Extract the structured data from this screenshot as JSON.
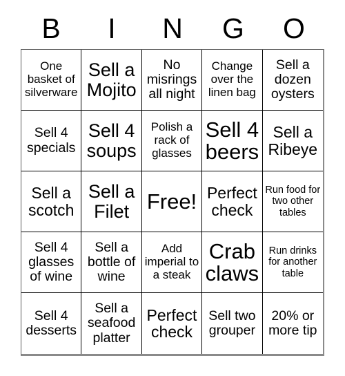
{
  "card": {
    "title_letters": [
      "B",
      "I",
      "N",
      "G",
      "O"
    ],
    "free_space_label": "Free!",
    "rows": [
      [
        {
          "text": "One basket of silverware",
          "size": "sz-s"
        },
        {
          "text": "Sell a Mojito",
          "size": "sz-xl"
        },
        {
          "text": "No misrings all night",
          "size": "sz-m"
        },
        {
          "text": "Change over the linen bag",
          "size": "sz-s"
        },
        {
          "text": "Sell a dozen oysters",
          "size": "sz-m"
        }
      ],
      [
        {
          "text": "Sell 4 specials",
          "size": "sz-m"
        },
        {
          "text": "Sell 4 soups",
          "size": "sz-xl"
        },
        {
          "text": "Polish a rack of glasses",
          "size": "sz-s"
        },
        {
          "text": "Sell 4 beers",
          "size": "sz-xxl"
        },
        {
          "text": "Sell a Ribeye",
          "size": "sz-l"
        }
      ],
      [
        {
          "text": "Sell a scotch",
          "size": "sz-l"
        },
        {
          "text": "Sell a Filet",
          "size": "sz-xl"
        },
        {
          "text": "Free!",
          "size": "sz-xxl"
        },
        {
          "text": "Perfect check",
          "size": "sz-l"
        },
        {
          "text": "Run food for two other tables",
          "size": "sz-xs"
        }
      ],
      [
        {
          "text": "Sell 4 glasses of wine",
          "size": "sz-m"
        },
        {
          "text": "Sell a bottle of wine",
          "size": "sz-m"
        },
        {
          "text": "Add imperial to a steak",
          "size": "sz-s"
        },
        {
          "text": "Crab claws",
          "size": "sz-xxl"
        },
        {
          "text": "Run drinks for another table",
          "size": "sz-xs"
        }
      ],
      [
        {
          "text": "Sell 4 desserts",
          "size": "sz-m"
        },
        {
          "text": "Sell a seafood platter",
          "size": "sz-m"
        },
        {
          "text": "Perfect check",
          "size": "sz-l"
        },
        {
          "text": "Sell two grouper",
          "size": "sz-m"
        },
        {
          "text": "20% or more tip",
          "size": "sz-m"
        }
      ]
    ]
  },
  "colors": {
    "background": "#ffffff",
    "text": "#000000",
    "grid_line": "#000000",
    "outer_shadow": "#8a8a8a"
  }
}
